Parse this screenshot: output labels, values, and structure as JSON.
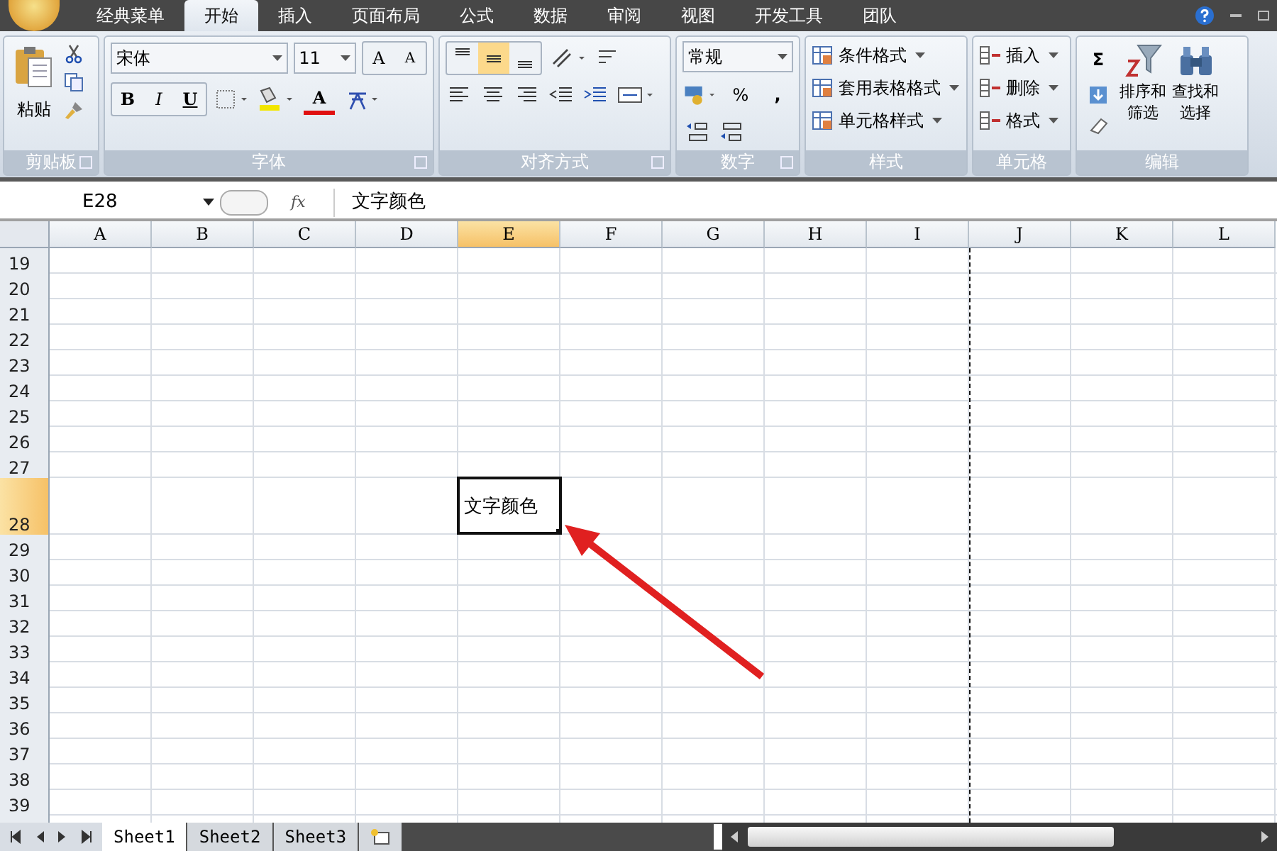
{
  "menu_tabs": [
    {
      "label": "经典菜单",
      "selected": false
    },
    {
      "label": "开始",
      "selected": true
    },
    {
      "label": "插入",
      "selected": false
    },
    {
      "label": "页面布局",
      "selected": false
    },
    {
      "label": "公式",
      "selected": false
    },
    {
      "label": "数据",
      "selected": false
    },
    {
      "label": "审阅",
      "selected": false
    },
    {
      "label": "视图",
      "selected": false
    },
    {
      "label": "开发工具",
      "selected": false
    },
    {
      "label": "团队",
      "selected": false
    }
  ],
  "ribbon": {
    "clipboard": {
      "label": "剪贴板",
      "paste": "粘贴"
    },
    "font": {
      "label": "字体",
      "font_name": "宋体",
      "font_size": "11",
      "grow": "A",
      "shrink": "A",
      "bold": "B",
      "italic": "I",
      "underline": "U",
      "font_color": "A"
    },
    "alignment": {
      "label": "对齐方式",
      "vertical": [
        {
          "kind": "top",
          "selected": false
        },
        {
          "kind": "middle",
          "selected": true
        },
        {
          "kind": "bottom",
          "selected": false
        }
      ]
    },
    "number": {
      "label": "数字",
      "format": "常规",
      "percent": "%",
      "comma": ","
    },
    "styles": {
      "label": "样式",
      "items": [
        "条件格式",
        "套用表格格式",
        "单元格样式"
      ]
    },
    "cells": {
      "label": "单元格",
      "items": [
        "插入",
        "删除",
        "格式"
      ]
    },
    "editing": {
      "label": "编辑",
      "sum": "Σ",
      "sort": [
        "排序和",
        "筛选"
      ],
      "find": [
        "查找和",
        "选择"
      ]
    }
  },
  "formula_bar": {
    "name_box": "E28",
    "function_label": "fx",
    "formula": "文字颜色"
  },
  "columns": [
    {
      "label": "A",
      "selected": false
    },
    {
      "label": "B",
      "selected": false
    },
    {
      "label": "C",
      "selected": false
    },
    {
      "label": "D",
      "selected": false
    },
    {
      "label": "E",
      "selected": true
    },
    {
      "label": "F",
      "selected": false
    },
    {
      "label": "G",
      "selected": false
    },
    {
      "label": "H",
      "selected": false
    },
    {
      "label": "I",
      "selected": false
    },
    {
      "label": "J",
      "selected": false
    },
    {
      "label": "K",
      "selected": false
    },
    {
      "label": "L",
      "selected": false
    }
  ],
  "rows": [
    {
      "label": "19",
      "selected": false
    },
    {
      "label": "20",
      "selected": false
    },
    {
      "label": "21",
      "selected": false
    },
    {
      "label": "22",
      "selected": false
    },
    {
      "label": "23",
      "selected": false
    },
    {
      "label": "24",
      "selected": false
    },
    {
      "label": "25",
      "selected": false
    },
    {
      "label": "26",
      "selected": false
    },
    {
      "label": "27",
      "selected": false
    },
    {
      "label": "28",
      "selected": true
    },
    {
      "label": "29",
      "selected": false
    },
    {
      "label": "30",
      "selected": false
    },
    {
      "label": "31",
      "selected": false
    },
    {
      "label": "32",
      "selected": false
    },
    {
      "label": "33",
      "selected": false
    },
    {
      "label": "34",
      "selected": false
    },
    {
      "label": "35",
      "selected": false
    },
    {
      "label": "36",
      "selected": false
    },
    {
      "label": "37",
      "selected": false
    },
    {
      "label": "38",
      "selected": false
    },
    {
      "label": "39",
      "selected": false
    }
  ],
  "active_cell": {
    "text": "文字颜色"
  },
  "sheet_tabs": [
    {
      "label": "Sheet1",
      "selected": true
    },
    {
      "label": "Sheet2",
      "selected": false
    },
    {
      "label": "Sheet3",
      "selected": false
    }
  ]
}
